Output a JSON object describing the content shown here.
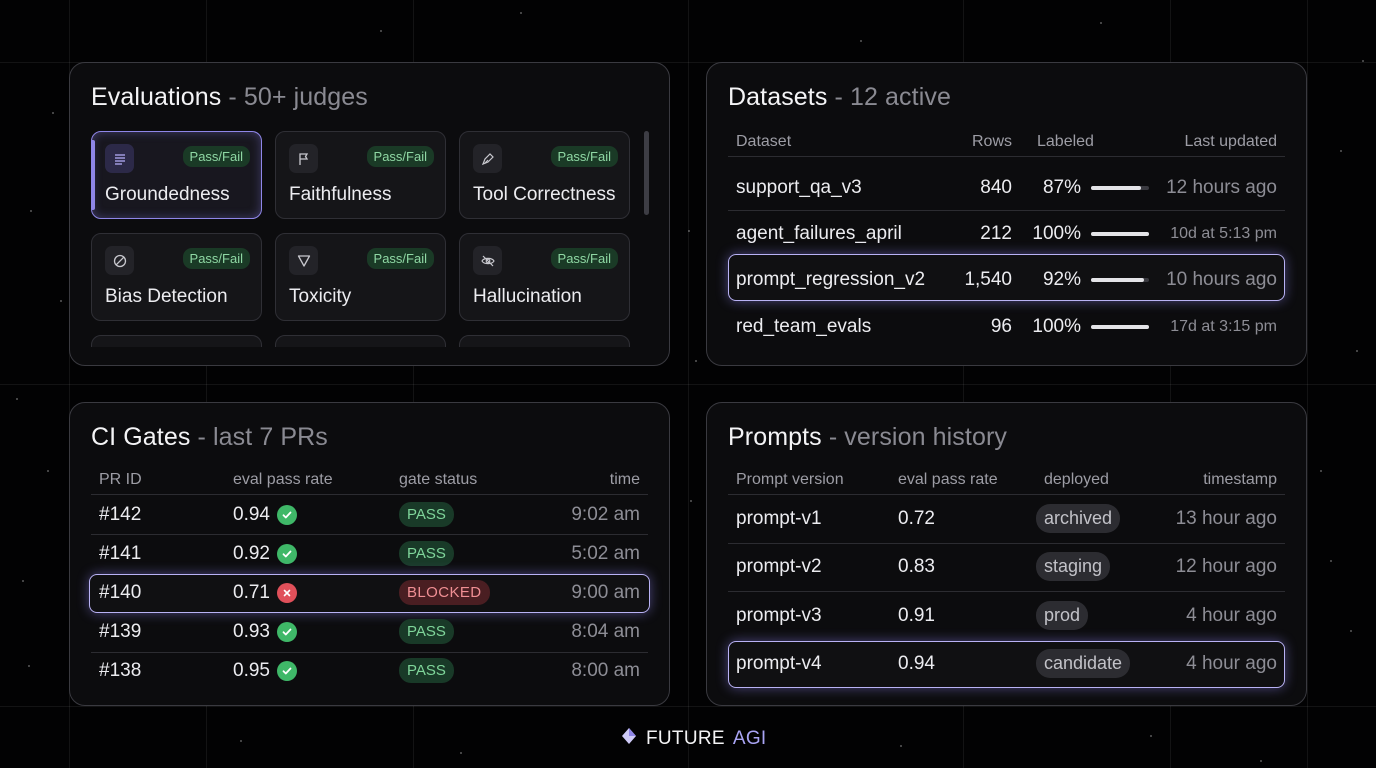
{
  "evaluations": {
    "title": "Evaluations",
    "subtitle": " - 50+ judges",
    "cards": [
      {
        "name": "Groundedness",
        "badge": "Pass/Fail",
        "icon": "list-lines-icon",
        "selected": true
      },
      {
        "name": "Faithfulness",
        "badge": "Pass/Fail",
        "icon": "flag-icon"
      },
      {
        "name": "Tool Correctness",
        "badge": "Pass/Fail",
        "icon": "pen-tool-icon"
      },
      {
        "name": "Bias Detection",
        "badge": "Pass/Fail",
        "icon": "block-icon"
      },
      {
        "name": "Toxicity",
        "badge": "Pass/Fail",
        "icon": "funnel-icon"
      },
      {
        "name": "Hallucination",
        "badge": "Pass/Fail",
        "icon": "eye-off-icon"
      }
    ]
  },
  "datasets": {
    "title": "Datasets",
    "subtitle": " - 12 active",
    "headers": {
      "dataset": "Dataset",
      "rows": "Rows",
      "labeled": "Labeled",
      "updated": "Last updated"
    },
    "rows": [
      {
        "name": "support_qa_v3",
        "rows": "840",
        "labeled": "87%",
        "fraction": 0.87,
        "updated": "12 hours ago",
        "small": false
      },
      {
        "name": "agent_failures_april",
        "rows": "212",
        "labeled": "100%",
        "fraction": 1.0,
        "updated": "10d at 5:13 pm",
        "small": true
      },
      {
        "name": "prompt_regression_v2",
        "rows": "1,540",
        "labeled": "92%",
        "fraction": 0.92,
        "updated": "10 hours ago",
        "small": false,
        "highlight": true
      },
      {
        "name": "red_team_evals",
        "rows": "96",
        "labeled": "100%",
        "fraction": 1.0,
        "updated": "17d at 3:15 pm",
        "small": true
      }
    ]
  },
  "ci": {
    "title": "CI Gates",
    "subtitle": " - last 7 PRs",
    "headers": {
      "pr": "PR ID",
      "rate": "eval pass rate",
      "status": "gate status",
      "time": "time"
    },
    "rows": [
      {
        "pr": "#142",
        "rate": "0.94",
        "ok": true,
        "status": "PASS",
        "time": "9:02 am"
      },
      {
        "pr": "#141",
        "rate": "0.92",
        "ok": true,
        "status": "PASS",
        "time": "5:02 am"
      },
      {
        "pr": "#140",
        "rate": "0.71",
        "ok": false,
        "status": "BLOCKED",
        "time": "9:00 am",
        "highlight": true
      },
      {
        "pr": "#139",
        "rate": "0.93",
        "ok": true,
        "status": "PASS",
        "time": "8:04 am"
      },
      {
        "pr": "#138",
        "rate": "0.95",
        "ok": true,
        "status": "PASS",
        "time": "8:00 am"
      }
    ]
  },
  "prompts": {
    "title": "Prompts",
    "subtitle": " - version history",
    "headers": {
      "version": "Prompt version",
      "rate": "eval pass rate",
      "deployed": "deployed",
      "timestamp": "timestamp"
    },
    "rows": [
      {
        "version": "prompt-v1",
        "rate": "0.72",
        "deployed": "archived",
        "timestamp": "13 hour ago"
      },
      {
        "version": "prompt-v2",
        "rate": "0.83",
        "deployed": "staging",
        "timestamp": "12 hour ago"
      },
      {
        "version": "prompt-v3",
        "rate": "0.91",
        "deployed": "prod",
        "timestamp": "4 hour ago"
      },
      {
        "version": "prompt-v4",
        "rate": "0.94",
        "deployed": "candidate",
        "timestamp": "4 hour ago",
        "highlight": true
      }
    ]
  },
  "brand": {
    "part1": "FUTURE",
    "part2": "AGI"
  },
  "colors": {
    "accent": "#8f86e8",
    "pass": "#3fb868",
    "blocked": "#e0505a"
  }
}
